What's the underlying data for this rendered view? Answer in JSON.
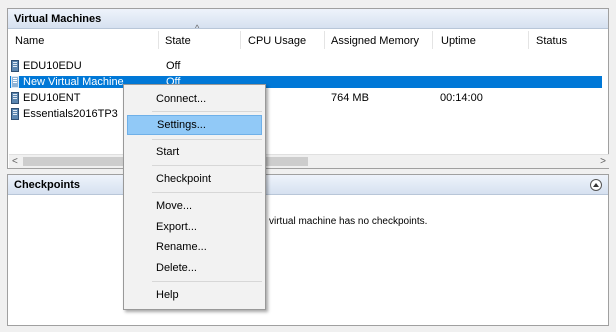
{
  "vm_panel": {
    "title": "Virtual Machines",
    "columns": [
      "Name",
      "State",
      "CPU Usage",
      "Assigned Memory",
      "Uptime",
      "Status"
    ],
    "rows": [
      {
        "name": "EDU10EDU",
        "state": "Off",
        "cpu": "",
        "memory": "",
        "uptime": "",
        "status": "",
        "selected": false
      },
      {
        "name": "New Virtual Machine",
        "state": "Off",
        "cpu": "",
        "memory": "",
        "uptime": "",
        "status": "",
        "selected": true
      },
      {
        "name": "EDU10ENT",
        "state": "",
        "cpu": "",
        "memory": "764 MB",
        "uptime": "00:14:00",
        "status": "",
        "selected": false
      },
      {
        "name": "Essentials2016TP3",
        "state": "",
        "cpu": "",
        "memory": "",
        "uptime": "",
        "status": "",
        "selected": false
      }
    ]
  },
  "scrollbar": {
    "left_arrow": "<",
    "right_arrow": ">"
  },
  "checkpoints_panel": {
    "title": "Checkpoints",
    "message": "virtual machine has no checkpoints."
  },
  "context_menu": {
    "items": [
      {
        "label": "Connect...",
        "highlighted": false
      },
      {
        "label": "Settings...",
        "highlighted": true
      },
      {
        "label": "Start",
        "highlighted": false
      },
      {
        "label": "Checkpoint",
        "highlighted": false
      },
      {
        "label": "Move...",
        "highlighted": false
      },
      {
        "label": "Export...",
        "highlighted": false
      },
      {
        "label": "Rename...",
        "highlighted": false
      },
      {
        "label": "Delete...",
        "highlighted": false
      },
      {
        "label": "Help",
        "highlighted": false
      }
    ]
  },
  "icons": {
    "vm": "vm-icon",
    "collapse": "collapse-up-icon",
    "sort": "sort-ascending-icon"
  },
  "colors": {
    "selection": "#0078d7",
    "menu_highlight": "#91c9f7",
    "header_gradient_top": "#eef3fb",
    "header_gradient_bottom": "#d6e1f0"
  }
}
